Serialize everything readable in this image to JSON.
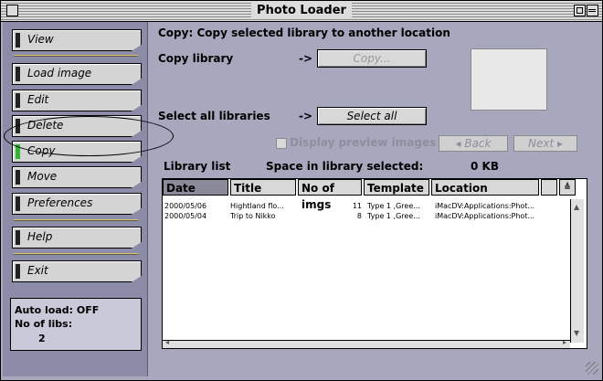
{
  "window": {
    "title": "Photo Loader"
  },
  "sidebar": {
    "buttons": [
      {
        "label": "View"
      },
      {
        "label": "Load image"
      },
      {
        "label": "Edit"
      },
      {
        "label": "Delete"
      },
      {
        "label": "Copy"
      },
      {
        "label": "Move"
      },
      {
        "label": "Preferences"
      },
      {
        "label": "Help"
      },
      {
        "label": "Exit"
      }
    ],
    "status": {
      "auto_load": "Auto load: OFF",
      "num_libs_label": "No of libs:",
      "num_libs_value": "2"
    }
  },
  "main": {
    "heading": "Copy: Copy selected library to another location",
    "copy_library_label": "Copy library",
    "arrow": "->",
    "copy_button": "Copy...",
    "select_all_label": "Select all libraries",
    "select_all_button": "Select all",
    "preview_checkbox_label": "Display preview images",
    "back_button": "◂ Back",
    "next_button": "Next ▸",
    "library_list_label": "Library list",
    "space_label": "Space in library selected:",
    "space_value": "0 KB"
  },
  "table": {
    "columns": [
      "Date",
      "Title",
      "No of imgs",
      "Template",
      "Location"
    ],
    "rows": [
      {
        "date": "2000/05/06",
        "title": "Hightland flo...",
        "imgs": "11",
        "template": "Type 1 ,Gree...",
        "location": "iMacDV:Applications:Phot..."
      },
      {
        "date": "2000/05/04",
        "title": "Trip to Nikko",
        "imgs": "8",
        "template": "Type 1 ,Gree...",
        "location": "iMacDV:Applications:Phot..."
      }
    ]
  },
  "colors": {
    "window_bg": "#a7a7be",
    "sidebar_bg": "#8c8ca8",
    "active_lamp": "#2fb52f"
  }
}
